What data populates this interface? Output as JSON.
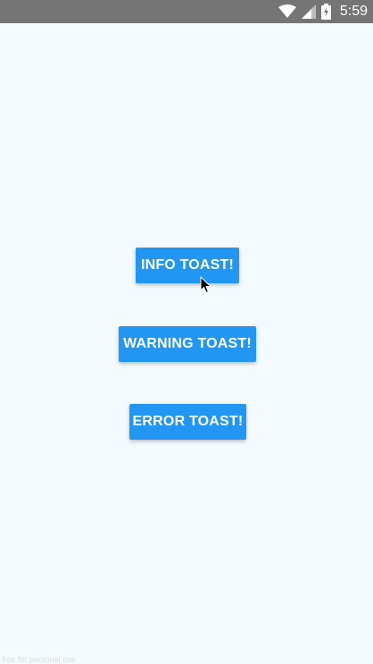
{
  "status_bar": {
    "time": "5:59",
    "battery_level": "charging",
    "icons": [
      "wifi-icon",
      "cell-signal-icon",
      "battery-charging-icon"
    ]
  },
  "buttons": {
    "info": "INFO TOAST!",
    "warning": "WARNING TOAST!",
    "error": "ERROR TOAST!"
  },
  "colors": {
    "status_bar": "#757575",
    "background": "#f3fbfe",
    "button": "#2196f3",
    "button_text": "#ffffff"
  },
  "watermark": "free for personal use"
}
